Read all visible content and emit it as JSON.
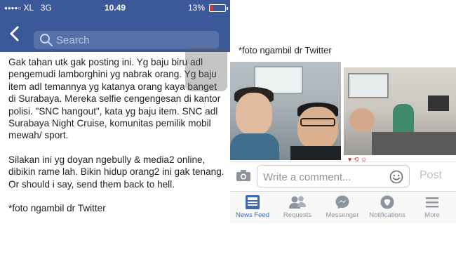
{
  "left_screen": {
    "status_bar": {
      "signal_dots": "●●●●○",
      "carrier": "XL",
      "network": "3G",
      "time": "10.49",
      "battery_percent": "13%"
    },
    "nav": {
      "search_placeholder": "Search"
    },
    "post": {
      "paragraph1": "Gak tahan utk gak posting ini. Yg baju biru adl pengemudi lamborghini yg nabrak orang. Yg baju item adl temannya yg katanya orang kaya banget di Surabaya. Mereka selfie cengengesan di kantor polisi. \"SNC hangout\", kata yg baju item. SNC adl Surabaya Night Cruise, komunitas pemilik mobil mewah/ sport.",
      "paragraph2": "Silakan ini yg doyan ngebully & media2 online, dibikin rame lah. Bikin hidup orang2 ini gak tenang. Or should i say, send them back to hell.",
      "paragraph3": "*foto ngambil dr Twitter"
    }
  },
  "right_screen": {
    "caption": "*foto ngambil dr Twitter",
    "comment": {
      "placeholder": "Write a comment...",
      "post_label": "Post"
    },
    "tabs": [
      {
        "label": "News Feed",
        "icon": "news-feed-icon",
        "active": true
      },
      {
        "label": "Requests",
        "icon": "requests-icon",
        "active": false
      },
      {
        "label": "Messenger",
        "icon": "messenger-icon",
        "active": false
      },
      {
        "label": "Notifications",
        "icon": "notifications-icon",
        "active": false
      },
      {
        "label": "More",
        "icon": "more-icon",
        "active": false
      }
    ]
  },
  "colors": {
    "brand_blue": "#3b5998",
    "active_tab": "#4267b2",
    "inactive_tab": "#8d949e"
  }
}
